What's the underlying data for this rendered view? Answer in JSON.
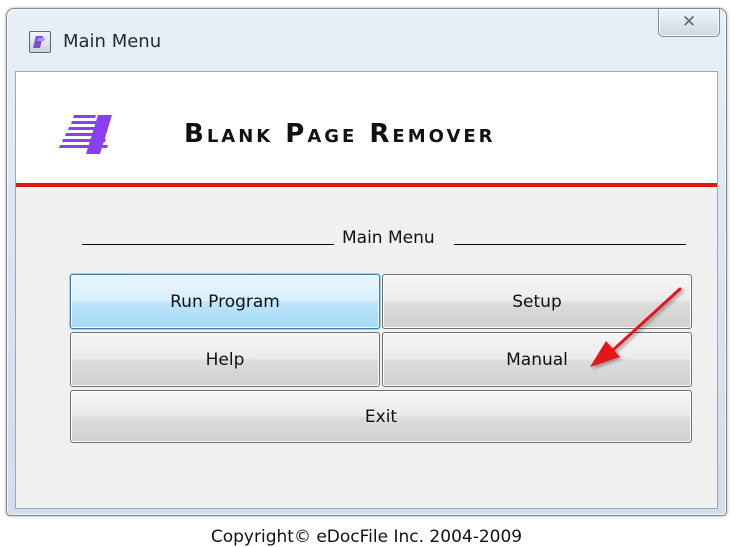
{
  "window": {
    "title": "Main Menu",
    "icon": "app-icon",
    "close_symbol": "✕"
  },
  "banner": {
    "product_title": "Blank Page Remover",
    "logo": "edocfile-logo",
    "accent_color": "#e4151b",
    "logo_color": "#8c3ff0"
  },
  "menu": {
    "header": "Main Menu",
    "buttons": {
      "run_program": "Run Program",
      "setup": "Setup",
      "help": "Help",
      "manual": "Manual",
      "exit": "Exit"
    },
    "focused_button": "Run Program"
  },
  "annotation": {
    "arrow_color": "#e4151b",
    "points_to": "Setup"
  },
  "footer": {
    "copyright": "Copyright© eDocFile Inc. 2004-2009"
  }
}
